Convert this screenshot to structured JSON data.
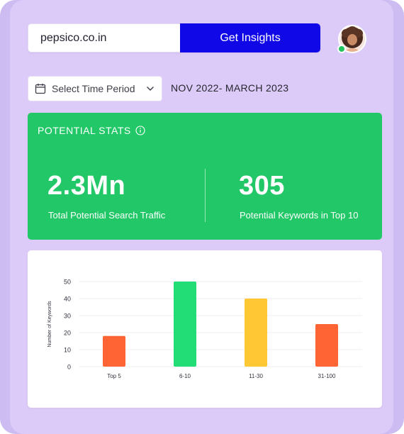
{
  "search": {
    "value": "pepsico.co.in",
    "button_label": "Get Insights"
  },
  "time_period": {
    "select_label": "Select Time Period",
    "range": "NOV 2022- MARCH 2023"
  },
  "stats": {
    "title": "POTENTIAL STATS",
    "items": [
      {
        "value": "2.3Mn",
        "label": "Total Potential Search Traffic"
      },
      {
        "value": "305",
        "label": "Potential Keywords in Top 10"
      }
    ]
  },
  "chart_data": {
    "type": "bar",
    "categories": [
      "Top 5",
      "6-10",
      "11-30",
      "31-100"
    ],
    "values": [
      18,
      50,
      40,
      25
    ],
    "colors": [
      "#ff6534",
      "#22dd75",
      "#ffc734",
      "#ff6534"
    ],
    "ylabel": "Number of Keywords",
    "yticks": [
      0,
      10,
      20,
      30,
      40,
      50
    ],
    "ylim": [
      0,
      50
    ],
    "grid": true
  },
  "colors": {
    "accent": "#1108e8",
    "stats_green": "#22c867",
    "background": "#dccbf8",
    "online": "#22c55e"
  },
  "icons": {
    "calendar": "calendar-icon",
    "chevron": "chevron-down-icon",
    "info": "info-icon",
    "avatar": "user-avatar"
  }
}
